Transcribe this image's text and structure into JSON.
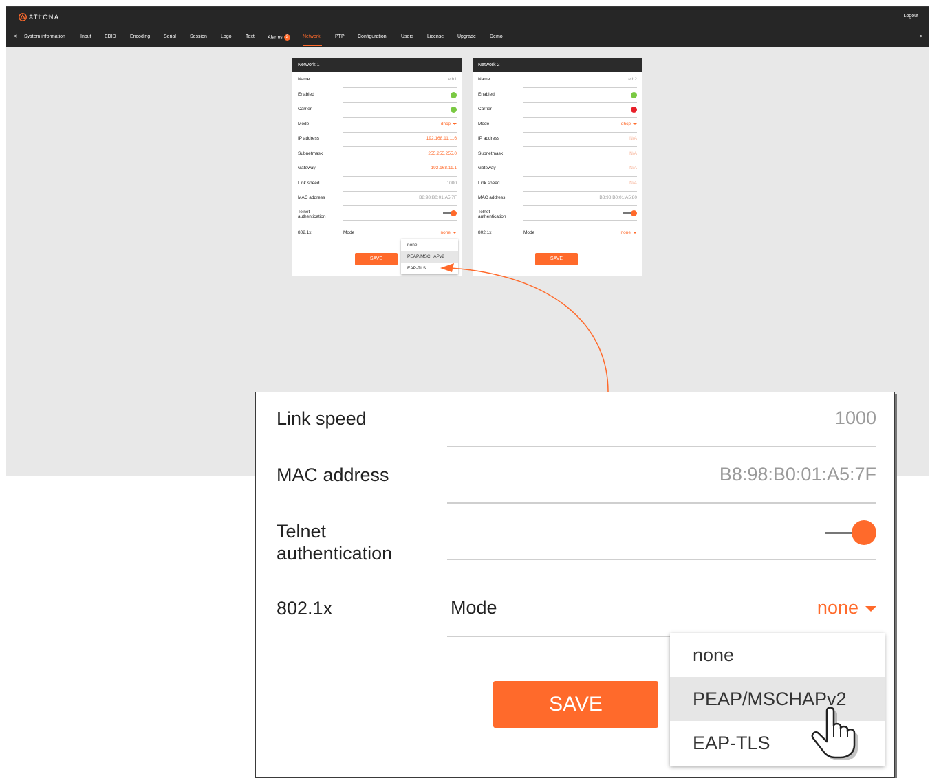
{
  "header": {
    "brand": "ATLONA",
    "brand_tagline": "Connecting Technology",
    "logout_label": "Logout"
  },
  "nav": {
    "prev_label": "<",
    "next_label": ">",
    "items": [
      {
        "label": "System information"
      },
      {
        "label": "Input"
      },
      {
        "label": "EDID"
      },
      {
        "label": "Encoding"
      },
      {
        "label": "Serial"
      },
      {
        "label": "Session"
      },
      {
        "label": "Logo"
      },
      {
        "label": "Text"
      },
      {
        "label": "Alarms",
        "badge": "2"
      },
      {
        "label": "Network",
        "active": true
      },
      {
        "label": "PTP"
      },
      {
        "label": "Configuration"
      },
      {
        "label": "Users"
      },
      {
        "label": "License"
      },
      {
        "label": "Upgrade"
      },
      {
        "label": "Demo"
      }
    ]
  },
  "labels": {
    "name": "Name",
    "enabled": "Enabled",
    "carrier": "Carrier",
    "mode": "Mode",
    "ip_address": "IP address",
    "subnetmask": "Subnetmask",
    "gateway": "Gateway",
    "link_speed": "Link speed",
    "mac_address": "MAC address",
    "telnet_line1": "Telnet",
    "telnet_line2": "authentication",
    "dot1x": "802.1x",
    "dot1x_mode": "Mode",
    "save": "SAVE"
  },
  "network1": {
    "title": "Network 1",
    "name": "eth1",
    "enabled": true,
    "carrier": true,
    "mode": "dhcp",
    "ip_address": "192.168.11.116",
    "subnetmask": "255.255.255.0",
    "gateway": "192.168.11.1",
    "link_speed": "1000",
    "mac_address": "B8:98:B0:01:A5:7F",
    "telnet_auth": true,
    "dot1x_mode": "none"
  },
  "network2": {
    "title": "Network 2",
    "name": "eth2",
    "enabled": true,
    "carrier": false,
    "mode": "dhcp",
    "ip_address": "N/A",
    "subnetmask": "N/A",
    "gateway": "N/A",
    "link_speed": "N/A",
    "mac_address": "B8:98:B0:01:A5:80",
    "telnet_auth": true,
    "dot1x_mode": "none"
  },
  "dot1x_dropdown": {
    "options": [
      "none",
      "PEAP/MSCHAPv2",
      "EAP-TLS"
    ],
    "highlighted": "PEAP/MSCHAPv2"
  },
  "colors": {
    "accent": "#ff6a2b",
    "status_ok": "#7ac943",
    "status_error": "#e8202a",
    "header_bg": "#262626"
  },
  "icons": {
    "logo": "atlona-logo-icon",
    "pointer": "hand-pointer-icon",
    "caret": "caret-down-icon"
  }
}
